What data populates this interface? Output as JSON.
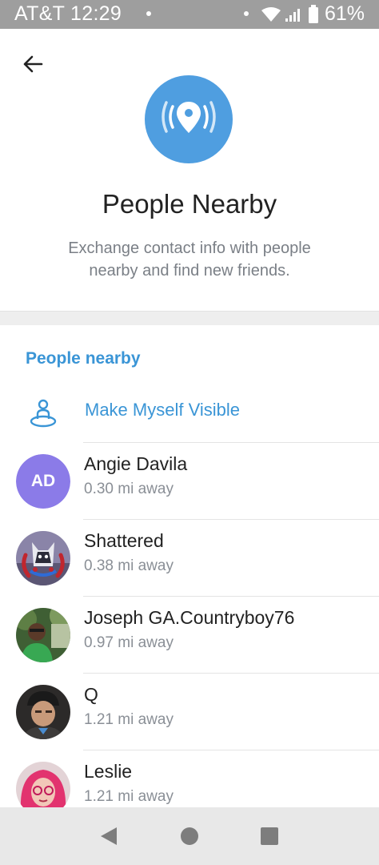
{
  "status_bar": {
    "carrier_time": "AT&T  12:29",
    "battery": "61%"
  },
  "header": {
    "title": "People Nearby",
    "subtitle": "Exchange contact info with people nearby and find new friends."
  },
  "section": {
    "title": "People nearby"
  },
  "make_visible": {
    "label": "Make Myself Visible"
  },
  "people": [
    {
      "name": "Angie Davila",
      "distance": "0.30 mi away",
      "initials": "AD"
    },
    {
      "name": "Shattered",
      "distance": "0.38 mi away"
    },
    {
      "name": "Joseph GA.Countryboy76",
      "distance": "0.97 mi away"
    },
    {
      "name": "Q",
      "distance": "1.21 mi away"
    },
    {
      "name": "Leslie",
      "distance": "1.21 mi away"
    }
  ],
  "colors": {
    "accent": "#3a95d6",
    "hero": "#4f9ee0",
    "initials_avatar": "#8b7be8"
  },
  "icons": {
    "back": "arrow-left-icon",
    "hero": "location-broadcast-icon",
    "make_visible": "person-on-map-icon",
    "nav_back": "triangle-back-icon",
    "nav_home": "circle-home-icon",
    "nav_recents": "square-recents-icon"
  }
}
